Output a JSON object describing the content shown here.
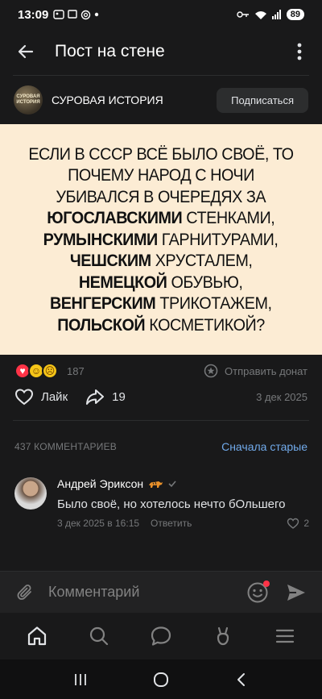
{
  "status_bar": {
    "time": "13:09",
    "battery": "89"
  },
  "header": {
    "title": "Пост на стене"
  },
  "author": {
    "name": "СУРОВАЯ ИСТОРИЯ",
    "avatar_text": "СУРОВАЯ ИСТОРИЯ",
    "subscribe_label": "Подписаться"
  },
  "post_image": {
    "line1": "ЕСЛИ В СССР ВСЁ БЫЛО СВОЁ, ТО",
    "line2": "ПОЧЕМУ НАРОД С НОЧИ",
    "line3": "УБИВАЛСЯ В ОЧЕРЕДЯХ ЗА",
    "line4_bold": "ЮГОСЛАВСКИМИ",
    "line4_rest": " СТЕНКАМИ,",
    "line5_bold": "РУМЫНСКИМИ",
    "line5_rest": " ГАРНИТУРАМИ,",
    "line6_bold": "ЧЕШСКИМ",
    "line6_rest": " ХРУСТАЛЕМ,",
    "line7_bold": "НЕМЕЦКОЙ",
    "line7_rest": " ОБУВЬЮ,",
    "line8_bold": "ВЕНГЕРСКИМ",
    "line8_rest": " ТРИКОТАЖЕМ,",
    "line9_bold": "ПОЛЬСКОЙ",
    "line9_rest": " КОСМЕТИКОЙ?"
  },
  "reactions": {
    "count": "187",
    "donate_label": "Отправить донат"
  },
  "actions": {
    "like_label": "Лайк",
    "share_count": "19",
    "date": "3 дек 2025"
  },
  "comments": {
    "count_label": "437 КОММЕНТАРИЕВ",
    "sort_label": "Сначала старые",
    "items": [
      {
        "author": "Андрей Эриксон",
        "text": "Было своё, но хотелось нечто бОльшего",
        "time": "3 дек 2025 в 16:15",
        "reply_label": "Ответить",
        "likes": "2"
      }
    ]
  },
  "input": {
    "placeholder": "Комментарий"
  },
  "colors": {
    "background": "#19191a",
    "accent": "#71aaeb",
    "secondary_text": "#76787a",
    "post_background": "#fcecd4",
    "notification_dot": "#ff3347"
  }
}
